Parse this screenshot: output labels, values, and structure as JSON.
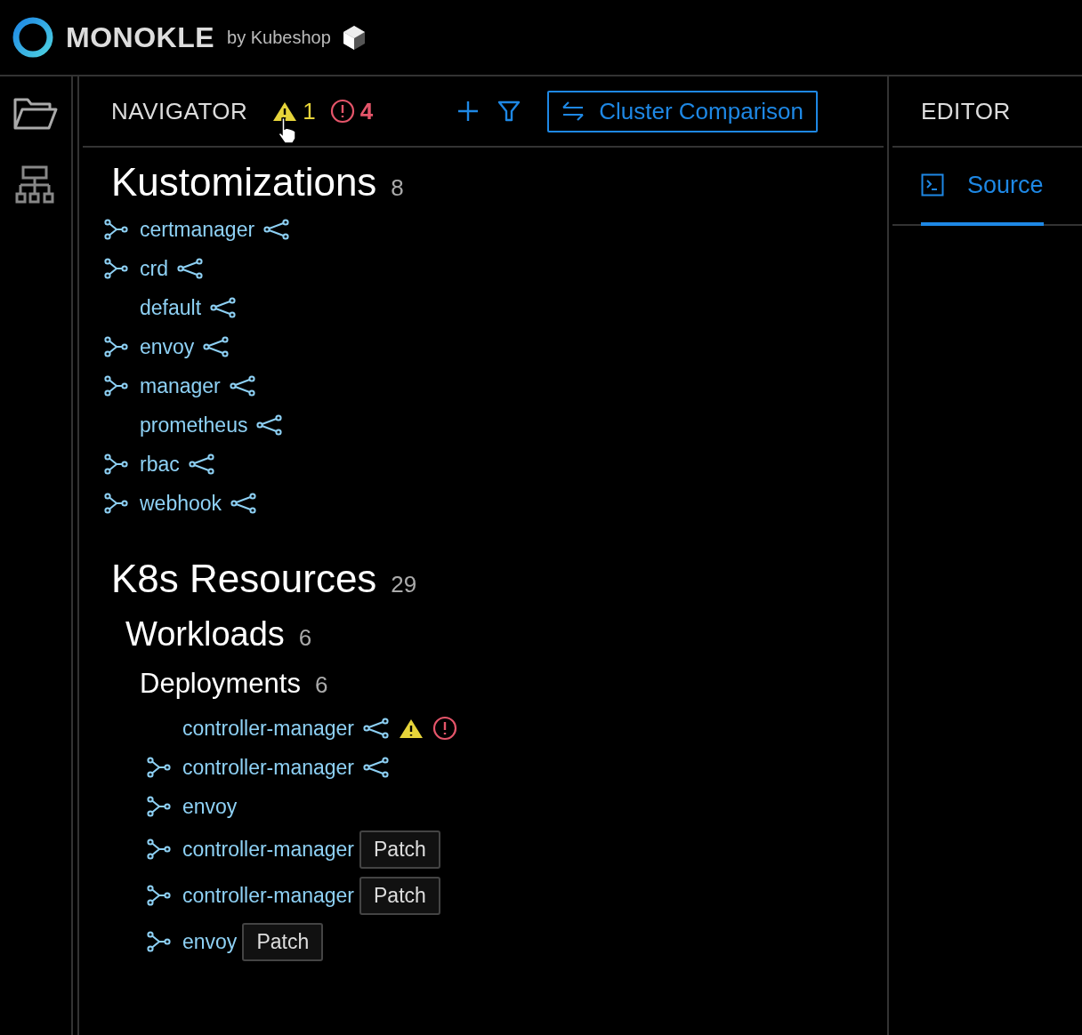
{
  "header": {
    "logo_text": "MONOKLE",
    "byline": "by Kubeshop"
  },
  "rail": {
    "items": [
      {
        "kind": "folder",
        "selected": true
      },
      {
        "kind": "tree",
        "selected": false
      }
    ]
  },
  "navigator": {
    "title": "NAVIGATOR",
    "warning_count": "1",
    "error_count": "4",
    "compare_button": "Cluster Comparison",
    "sections": [
      {
        "title": "Kustomizations",
        "count": "8",
        "items": [
          {
            "name": "certmanager",
            "linked": true,
            "graph": true,
            "warning": false,
            "error": false
          },
          {
            "name": "crd",
            "linked": true,
            "graph": true,
            "warning": false,
            "error": false
          },
          {
            "name": "default",
            "linked": false,
            "graph": true,
            "warning": false,
            "error": false
          },
          {
            "name": "envoy",
            "linked": true,
            "graph": true,
            "warning": false,
            "error": false
          },
          {
            "name": "manager",
            "linked": true,
            "graph": true,
            "warning": false,
            "error": false
          },
          {
            "name": "prometheus",
            "linked": false,
            "graph": true,
            "warning": false,
            "error": false
          },
          {
            "name": "rbac",
            "linked": true,
            "graph": true,
            "warning": false,
            "error": false
          },
          {
            "name": "webhook",
            "linked": true,
            "graph": true,
            "warning": false,
            "error": false
          }
        ]
      },
      {
        "title": "K8s Resources",
        "count": "29",
        "children": [
          {
            "title": "Workloads",
            "count": "6",
            "children": [
              {
                "title": "Deployments",
                "count": "6",
                "items": [
                  {
                    "name": "controller-manager",
                    "linked": false,
                    "graph": true,
                    "warning": true,
                    "error": true
                  },
                  {
                    "name": "controller-manager",
                    "linked": true,
                    "graph": true,
                    "warning": false,
                    "error": false
                  },
                  {
                    "name": "envoy",
                    "linked": true,
                    "graph": false,
                    "warning": false,
                    "error": false
                  },
                  {
                    "name": "controller-manager",
                    "linked": true,
                    "graph": false,
                    "warning": false,
                    "error": false,
                    "tag": "Patch"
                  },
                  {
                    "name": "controller-manager",
                    "linked": true,
                    "graph": false,
                    "warning": false,
                    "error": false,
                    "tag": "Patch"
                  },
                  {
                    "name": "envoy",
                    "linked": true,
                    "graph": false,
                    "warning": false,
                    "error": false,
                    "tag": "Patch"
                  }
                ]
              }
            ]
          }
        ]
      }
    ]
  },
  "editor": {
    "title": "EDITOR",
    "tabs": [
      {
        "label": "Source",
        "selected": true
      }
    ]
  }
}
